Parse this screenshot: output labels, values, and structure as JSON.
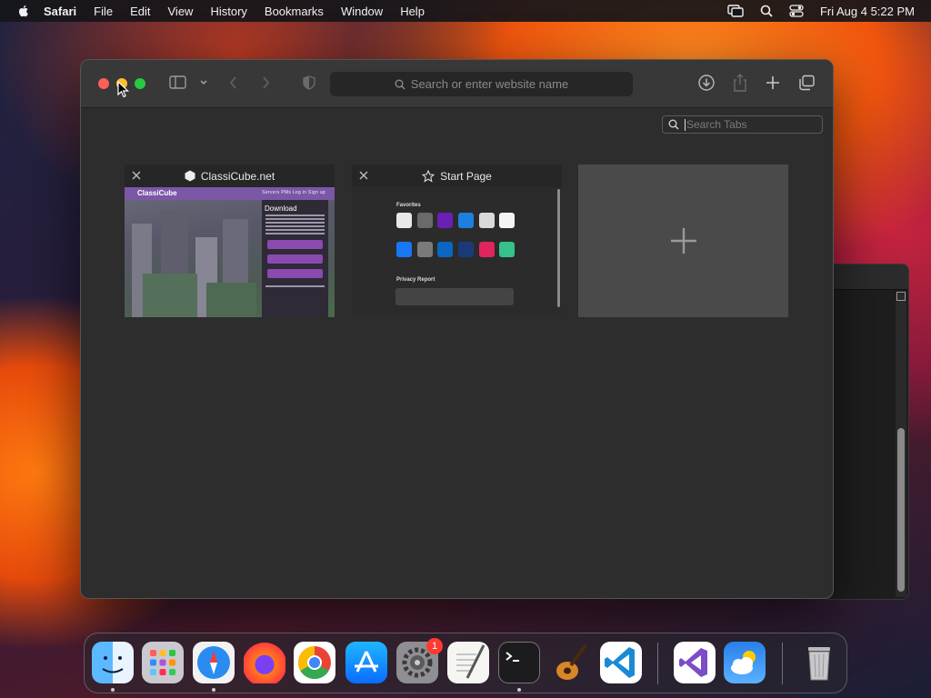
{
  "menubar": {
    "app_name": "Safari",
    "menus": [
      "File",
      "Edit",
      "View",
      "History",
      "Bookmarks",
      "Window",
      "Help"
    ],
    "clock": "Fri Aug 4  5:22 PM"
  },
  "safari": {
    "address_placeholder": "Search or enter website name",
    "search_tabs_placeholder": "Search Tabs",
    "tabs": [
      {
        "title": "ClassiCube.net",
        "thumb": {
          "brand": "ClassiCube",
          "nav": "Servers  PMs  Log in     Sign up",
          "heading": "Download"
        }
      },
      {
        "title": "Start Page",
        "thumb": {
          "favorites_label": "Favorites",
          "privacy_label": "Privacy Report"
        }
      }
    ]
  },
  "dock": {
    "apps": [
      "Finder",
      "Launchpad",
      "Safari",
      "Firefox",
      "Google Chrome",
      "App Store",
      "System Settings",
      "TextEdit",
      "Terminal",
      "GarageBand",
      "Visual Studio Code",
      "Visual Studio",
      "Weather",
      "Trash"
    ],
    "settings_badge": "1"
  },
  "colors": {
    "close": "#ff5f57",
    "minimize": "#febc2e",
    "maximize": "#28c840",
    "classicube_purple": "#7b57a8"
  }
}
